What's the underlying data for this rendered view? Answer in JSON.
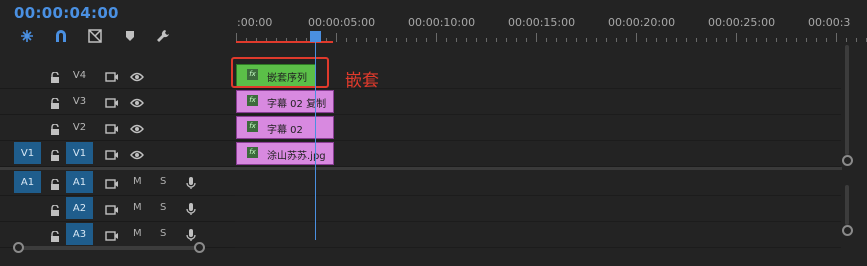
{
  "timecode": "00:00:04:00",
  "toolbar": [
    {
      "name": "snap-icon"
    },
    {
      "name": "linked-selection-icon"
    },
    {
      "name": "add-marker-icon"
    },
    {
      "name": "marker-icon"
    },
    {
      "name": "wrench-icon"
    }
  ],
  "ruler": {
    "ticks": [
      ":00:00",
      "00:00:05:00",
      "00:00:10:00",
      "00:00:15:00",
      "00:00:20:00",
      "00:00:25:00",
      "00:00:3"
    ]
  },
  "tracks": {
    "video": [
      {
        "name": "V4",
        "source": ""
      },
      {
        "name": "V3",
        "source": ""
      },
      {
        "name": "V2",
        "source": ""
      },
      {
        "name": "V1",
        "source": "V1"
      }
    ],
    "audio": [
      {
        "name": "A1",
        "source": "A1",
        "m": "M",
        "s": "S"
      },
      {
        "name": "A2",
        "source": "",
        "m": "M",
        "s": "S"
      },
      {
        "name": "A3",
        "source": "",
        "m": "M",
        "s": "S"
      }
    ]
  },
  "clips": [
    {
      "label": "嵌套序列",
      "color": "#5bbf48"
    },
    {
      "label": "字幕 02 复制",
      "color": "#d889e0"
    },
    {
      "label": "字幕 02",
      "color": "#d889e0"
    },
    {
      "label": "涂山苏苏.jpg",
      "color": "#d889e0"
    }
  ],
  "fx_label": "fx",
  "annotation": "嵌套",
  "colors": {
    "accent": "#4a90e2",
    "highlight": "#e03a2c",
    "track_active": "#1f5d8c"
  }
}
